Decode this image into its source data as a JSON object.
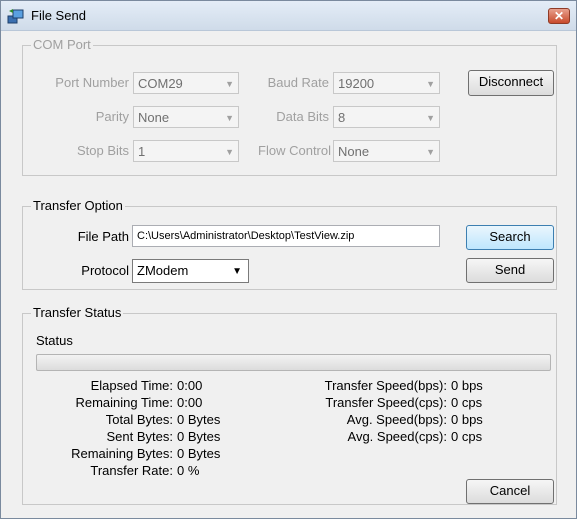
{
  "window": {
    "title": "File Send",
    "close_glyph": "✕",
    "icon": "file-send-app-icon"
  },
  "com_port": {
    "legend": "COM Port",
    "port_number_label": "Port Number",
    "port_number_value": "COM29",
    "baud_rate_label": "Baud Rate",
    "baud_rate_value": "19200",
    "parity_label": "Parity",
    "parity_value": "None",
    "data_bits_label": "Data Bits",
    "data_bits_value": "8",
    "stop_bits_label": "Stop Bits",
    "stop_bits_value": "1",
    "flow_control_label": "Flow Control",
    "flow_control_value": "None",
    "disconnect_label": "Disconnect"
  },
  "transfer_option": {
    "legend": "Transfer Option",
    "file_path_label": "File Path",
    "file_path_value": "C:\\Users\\Administrator\\Desktop\\TestView.zip",
    "protocol_label": "Protocol",
    "protocol_value": "ZModem",
    "search_label": "Search",
    "send_label": "Send"
  },
  "transfer_status": {
    "legend": "Transfer Status",
    "status_label": "Status",
    "progress": 0,
    "left": [
      {
        "label": "Elapsed Time:",
        "value": "0:00"
      },
      {
        "label": "Remaining Time:",
        "value": "0:00"
      },
      {
        "label": "Total Bytes:",
        "value": "0 Bytes"
      },
      {
        "label": "Sent Bytes:",
        "value": "0 Bytes"
      },
      {
        "label": "Remaining Bytes:",
        "value": "0 Bytes"
      },
      {
        "label": "Transfer Rate:",
        "value": "0 %"
      }
    ],
    "right": [
      {
        "label": "Transfer Speed(bps):",
        "value": "0 bps"
      },
      {
        "label": "Transfer Speed(cps):",
        "value": "0 cps"
      },
      {
        "label": "Avg. Speed(bps):",
        "value": "0 bps"
      },
      {
        "label": "Avg. Speed(cps):",
        "value": "0 cps"
      }
    ],
    "cancel_label": "Cancel"
  },
  "colors": {
    "disabled_text": "#a0a0a0",
    "focus_border": "#3c7fb1",
    "close_button": "#c84a2c"
  }
}
